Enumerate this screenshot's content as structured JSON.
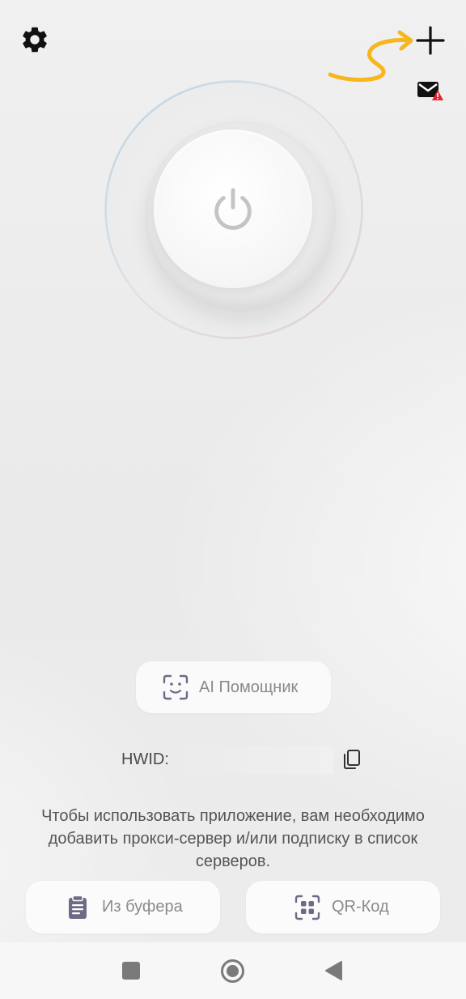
{
  "header": {
    "settings_icon": "gear-icon",
    "add_icon": "plus-icon",
    "mail_icon": "mail-alert-icon",
    "annotation_color": "#F7B61E"
  },
  "power": {
    "icon": "power-icon"
  },
  "ai_helper": {
    "label": "AI Помощник",
    "icon": "face-scan-icon"
  },
  "hwid": {
    "label": "HWID:",
    "copy_icon": "copy-icon"
  },
  "info_text": "Чтобы использовать приложение, вам необходимо добавить прокси-сервер и/или подписку в список серверов.",
  "actions": {
    "clipboard": {
      "label": "Из буфера",
      "icon": "clipboard-icon"
    },
    "qr": {
      "label": "QR-Код",
      "icon": "qr-icon"
    }
  },
  "navbar": {
    "recents_icon": "square-icon",
    "home_icon": "circle-icon",
    "back_icon": "triangle-back-icon"
  },
  "colors": {
    "accent_icon": "#6f6a85",
    "alert": "#e0242b"
  }
}
